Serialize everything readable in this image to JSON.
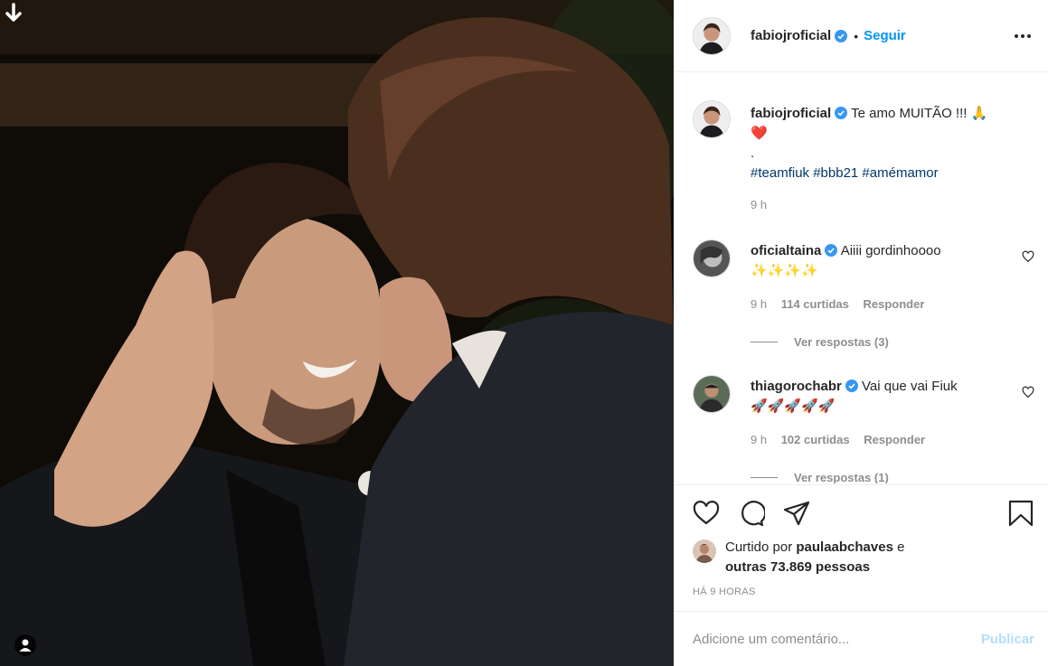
{
  "photo": {
    "top_icon": "arrow-down-icon",
    "user_tag_icon": "user-icon"
  },
  "header": {
    "username": "fabiojroficial",
    "separator": "•",
    "follow_label": "Seguir",
    "more_icon": "more-options-icon"
  },
  "caption": {
    "username": "fabiojroficial",
    "text": "Te amo MUITÃO !!! 🙏",
    "line2": "❤️",
    "line3": ".",
    "hashtags": "#teamfiuk #bbb21 #amémamor",
    "time": "9 h"
  },
  "comments": [
    {
      "username": "oficialtaina",
      "text": "Aiiii gordinhoooo",
      "emoji": "✨✨✨✨",
      "time": "9 h",
      "likes": "114 curtidas",
      "reply": "Responder",
      "view_replies": "Ver respostas (3)"
    },
    {
      "username": "thiagorochabr",
      "text": "Vai que vai Fiuk",
      "emoji": "🚀🚀🚀🚀🚀",
      "time": "9 h",
      "likes": "102 curtidas",
      "reply": "Responder",
      "view_replies": "Ver respostas (1)"
    }
  ],
  "likes": {
    "prefix": "Curtido por",
    "user": "paulaabchaves",
    "joiner": "e",
    "others": "outras 73.869 pessoas"
  },
  "post_time": "HÁ 9 HORAS",
  "add_comment": {
    "placeholder": "Adicione um comentário...",
    "publish_label": "Publicar"
  },
  "colors": {
    "link": "#0095f6",
    "hashtag": "#00376b",
    "muted": "#8e8e8e",
    "publish_disabled": "#b2dffc",
    "verified": "#3897f0"
  }
}
